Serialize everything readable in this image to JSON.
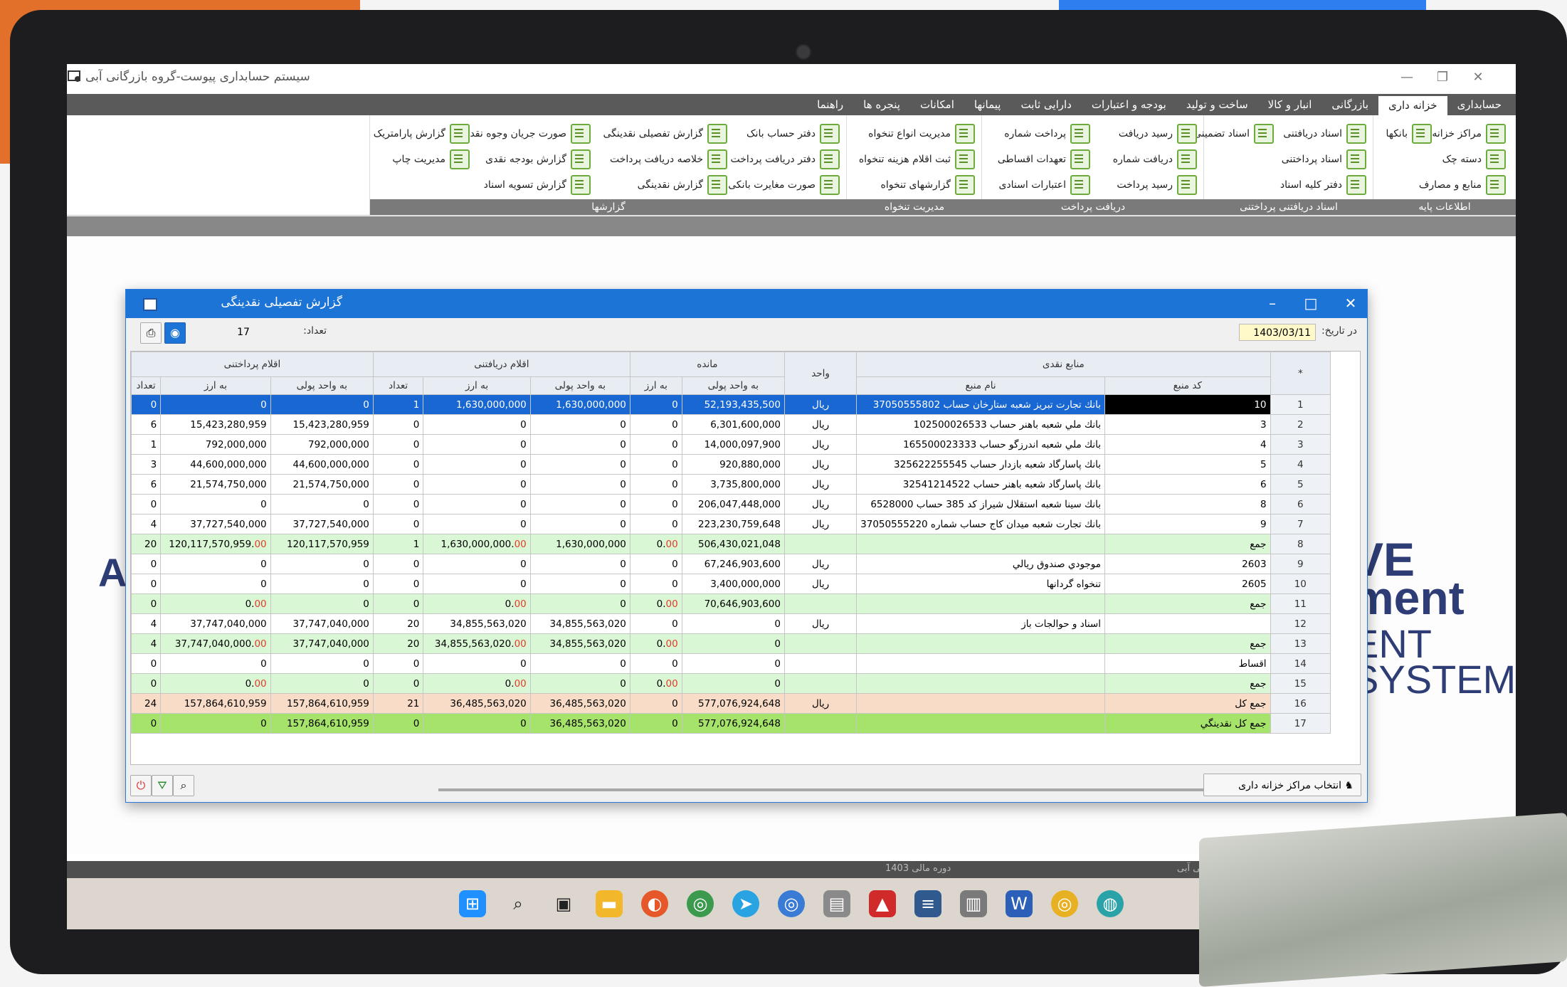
{
  "app": {
    "title": "سیستم حسابداری پیوست-گروه بازرگانی آبی",
    "window_controls": [
      "—",
      "❐",
      "✕"
    ]
  },
  "menu": [
    {
      "label": "حسابداری",
      "active": false
    },
    {
      "label": "خزانه داری",
      "active": true
    },
    {
      "label": "بازرگانی",
      "active": false
    },
    {
      "label": "انبار و کالا",
      "active": false
    },
    {
      "label": "ساخت و تولید",
      "active": false
    },
    {
      "label": "بودجه و اعتبارات",
      "active": false
    },
    {
      "label": "دارایی ثابت",
      "active": false
    },
    {
      "label": "پیمانها",
      "active": false
    },
    {
      "label": "امکانات",
      "active": false
    },
    {
      "label": "پنجره ها",
      "active": false
    },
    {
      "label": "راهنما",
      "active": false
    }
  ],
  "ribbon": {
    "groups": {
      "base": "اطلاعات پایه",
      "docs": "اسناد دریافتنی پرداختنی",
      "pay": "دریافت پرداخت",
      "tankhah": "مدیریت تنخواه",
      "reports": "گزارشها"
    },
    "base": [
      "مراکز خزانه",
      "بانکها",
      "دسته چک",
      "منابع و مصارف"
    ],
    "docs": [
      "اسناد دریافتنی",
      "اسناد تضمینی",
      "اسناد پرداختنی",
      "دفتر کلیه اسناد"
    ],
    "pay": [
      "رسید دریافت",
      "پرداخت شماره",
      "دریافت شماره",
      "تعهدات اقساطی",
      "رسید پرداخت",
      "اعتبارات اسنادی"
    ],
    "tankhah": [
      "مدیریت انواع تنخواه",
      "ثبت اقلام هزینه تنخواه",
      "گزارشهای تنخواه"
    ],
    "reports": [
      "دفتر حساب بانک",
      "گزارش تفصیلی نقدینگی",
      "صورت جریان وجوه نقد",
      "گزارش پارامتریک",
      "دفتر دریافت پرداخت",
      "خلاصه دریافت پرداخت",
      "گزارش بودجه نقدی",
      "مدیریت چاپ",
      "صورت مغایرت بانکی",
      "گزارش نقدینگی",
      "گزارش تسویه اسناد"
    ]
  },
  "background_text": {
    "left": "Al",
    "line1": "VE",
    "line2": "ment",
    "line3": "ENT",
    "line4": "SYSTEM"
  },
  "dialog": {
    "title": "گزارش تفصیلی نقدینگی",
    "date_label": "در تاریخ:",
    "date_value": "1403/03/11",
    "count_label": "تعداد:",
    "count_value": "17",
    "select_centers_button": "انتخاب مراکز خزانه داری",
    "col_groups": {
      "sources": "منابع نقدی",
      "unit": "واحد",
      "balance": "مانده",
      "receivable": "اقلام دریافتنی",
      "payable": "اقلام پرداختنی"
    },
    "sub_headers": {
      "row": "*",
      "code": "کد منبع",
      "name": "نام منبع",
      "amount_unit": "به واحد پولی",
      "amount_fx": "به ارز",
      "count": "تعداد"
    },
    "rows": [
      {
        "n": "1",
        "code": "10",
        "name": "بانك تجارت تبريز شعبه ستارخان حساب 37050555802",
        "unit": "ریال",
        "bal_u": "52,193,435,500",
        "bal_fx": "0",
        "rec_u": "1,630,000,000",
        "rec_fx": "1,630,000,000",
        "rec_c": "1",
        "pay_u": "0",
        "pay_fx": "0",
        "pay_c": "0",
        "kind": "sel"
      },
      {
        "n": "2",
        "code": "3",
        "name": "بانك ملي شعبه باهنر حساب 102500026533",
        "unit": "ریال",
        "bal_u": "6,301,600,000",
        "bal_fx": "0",
        "rec_u": "0",
        "rec_fx": "0",
        "rec_c": "0",
        "pay_u": "15,423,280,959",
        "pay_fx": "15,423,280,959",
        "pay_c": "6",
        "kind": ""
      },
      {
        "n": "3",
        "code": "4",
        "name": "بانك ملي شعبه اندرزگو حساب 165500023333",
        "unit": "ریال",
        "bal_u": "14,000,097,900",
        "bal_fx": "0",
        "rec_u": "0",
        "rec_fx": "0",
        "rec_c": "0",
        "pay_u": "792,000,000",
        "pay_fx": "792,000,000",
        "pay_c": "1",
        "kind": ""
      },
      {
        "n": "4",
        "code": "5",
        "name": "بانك پاسارگاد شعبه بازدار حساب 325622255545",
        "unit": "ریال",
        "bal_u": "920,880,000",
        "bal_fx": "0",
        "rec_u": "0",
        "rec_fx": "0",
        "rec_c": "0",
        "pay_u": "44,600,000,000",
        "pay_fx": "44,600,000,000",
        "pay_c": "3",
        "kind": ""
      },
      {
        "n": "5",
        "code": "6",
        "name": "بانك پاسارگاد شعبه باهنر حساب 32541214522",
        "unit": "ریال",
        "bal_u": "3,735,800,000",
        "bal_fx": "0",
        "rec_u": "0",
        "rec_fx": "0",
        "rec_c": "0",
        "pay_u": "21,574,750,000",
        "pay_fx": "21,574,750,000",
        "pay_c": "6",
        "kind": ""
      },
      {
        "n": "6",
        "code": "8",
        "name": "بانك سينا شعبه استقلال شيراز كد 385 حساب 6528000",
        "unit": "ریال",
        "bal_u": "206,047,448,000",
        "bal_fx": "0",
        "rec_u": "0",
        "rec_fx": "0",
        "rec_c": "0",
        "pay_u": "0",
        "pay_fx": "0",
        "pay_c": "0",
        "kind": ""
      },
      {
        "n": "7",
        "code": "9",
        "name": "بانك تجارت شعبه ميدان كاج حساب شماره 37050555220",
        "unit": "ریال",
        "bal_u": "223,230,759,648",
        "bal_fx": "0",
        "rec_u": "0",
        "rec_fx": "0",
        "rec_c": "0",
        "pay_u": "37,727,540,000",
        "pay_fx": "37,727,540,000",
        "pay_c": "4",
        "kind": ""
      },
      {
        "n": "8",
        "code": "جمع",
        "name": "",
        "unit": "",
        "bal_u": "506,430,021,048",
        "bal_fx": "0.",
        "bal_fx_red": "00",
        "rec_u": "1,630,000,000",
        "rec_fx": "1,630,000,000.",
        "rec_fx_red": "00",
        "rec_c": "1",
        "pay_u": "120,117,570,959",
        "pay_fx": "120,117,570,959.",
        "pay_fx_red": "00",
        "pay_c": "20",
        "kind": "sum"
      },
      {
        "n": "9",
        "code": "2603",
        "name": "موجودي صندوق ريالي",
        "unit": "ریال",
        "bal_u": "67,246,903,600",
        "bal_fx": "0",
        "rec_u": "0",
        "rec_fx": "0",
        "rec_c": "0",
        "pay_u": "0",
        "pay_fx": "0",
        "pay_c": "0",
        "kind": ""
      },
      {
        "n": "10",
        "code": "2605",
        "name": "تنخواه گردانها",
        "unit": "ریال",
        "bal_u": "3,400,000,000",
        "bal_fx": "0",
        "rec_u": "0",
        "rec_fx": "0",
        "rec_c": "0",
        "pay_u": "0",
        "pay_fx": "0",
        "pay_c": "0",
        "kind": ""
      },
      {
        "n": "11",
        "code": "جمع",
        "name": "",
        "unit": "",
        "bal_u": "70,646,903,600",
        "bal_fx": "0.",
        "bal_fx_red": "00",
        "rec_u": "0",
        "rec_fx": "0.",
        "rec_fx_red": "00",
        "rec_c": "0",
        "pay_u": "0",
        "pay_fx": "0.",
        "pay_fx_red": "00",
        "pay_c": "0",
        "kind": "sum"
      },
      {
        "n": "12",
        "code": "",
        "name": "اسناد و حوالجات باز",
        "unit": "ریال",
        "bal_u": "0",
        "bal_fx": "0",
        "rec_u": "34,855,563,020",
        "rec_fx": "34,855,563,020",
        "rec_c": "20",
        "pay_u": "37,747,040,000",
        "pay_fx": "37,747,040,000",
        "pay_c": "4",
        "kind": ""
      },
      {
        "n": "13",
        "code": "جمع",
        "name": "",
        "unit": "",
        "bal_u": "0",
        "bal_fx": "0.",
        "bal_fx_red": "00",
        "rec_u": "34,855,563,020",
        "rec_fx": "34,855,563,020.",
        "rec_fx_red": "00",
        "rec_c": "20",
        "pay_u": "37,747,040,000",
        "pay_fx": "37,747,040,000.",
        "pay_fx_red": "00",
        "pay_c": "4",
        "kind": "sum"
      },
      {
        "n": "14",
        "code": "اقساط",
        "name": "",
        "unit": "",
        "bal_u": "0",
        "bal_fx": "0",
        "rec_u": "0",
        "rec_fx": "0",
        "rec_c": "0",
        "pay_u": "0",
        "pay_fx": "0",
        "pay_c": "0",
        "kind": ""
      },
      {
        "n": "15",
        "code": "جمع",
        "name": "",
        "unit": "",
        "bal_u": "0",
        "bal_fx": "0.",
        "bal_fx_red": "00",
        "rec_u": "0",
        "rec_fx": "0.",
        "rec_fx_red": "00",
        "rec_c": "0",
        "pay_u": "0",
        "pay_fx": "0.",
        "pay_fx_red": "00",
        "pay_c": "0",
        "kind": "sum"
      },
      {
        "n": "16",
        "code": "جمع كل",
        "name": "",
        "unit": "ریال",
        "bal_u": "577,076,924,648",
        "bal_fx": "0",
        "rec_u": "36,485,563,020",
        "rec_fx": "36,485,563,020",
        "rec_c": "21",
        "pay_u": "157,864,610,959",
        "pay_fx": "157,864,610,959",
        "pay_c": "24",
        "kind": "grand"
      },
      {
        "n": "17",
        "code": "جمع كل نقدينگي",
        "name": "",
        "unit": "",
        "bal_u": "577,076,924,648",
        "bal_fx": "0",
        "rec_u": "36,485,563,020",
        "rec_fx": "0",
        "rec_c": "0",
        "pay_u": "157,864,610,959",
        "pay_fx": "0",
        "pay_c": "0",
        "kind": "total"
      }
    ]
  },
  "statusbar": {
    "period": "دوره مالی 1403",
    "company": "بازرگانی آبی"
  },
  "taskbar_icons": [
    "windows-start",
    "search",
    "task-view",
    "file-explorer",
    "firefox",
    "chrome",
    "telegram",
    "chrome-dev",
    "app-a",
    "acrobat",
    "app-b",
    "accounting-app",
    "word",
    "chrome-canary",
    "browser-extra"
  ]
}
